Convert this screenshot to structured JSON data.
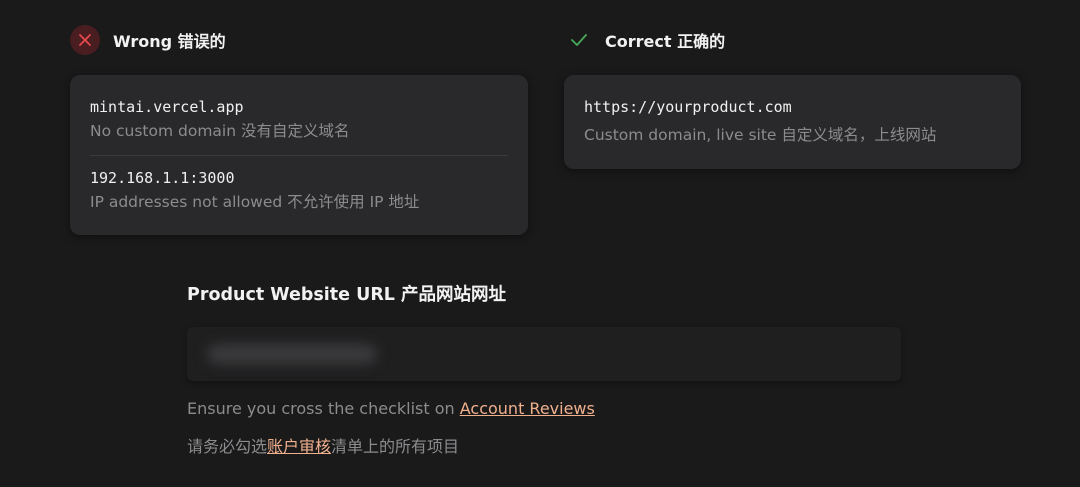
{
  "wrong": {
    "title": "Wrong  错误的",
    "examples": [
      {
        "value": "mintai.vercel.app",
        "note": "No custom domain  没有自定义域名"
      },
      {
        "value": "192.168.1.1:3000",
        "note": "IP addresses not allowed  不允许使用 IP 地址"
      }
    ]
  },
  "correct": {
    "title": "Correct  正确的",
    "examples": [
      {
        "value": "https://yourproduct.com",
        "note": "Custom domain, live site  自定义域名，上线网站"
      }
    ]
  },
  "field": {
    "label": "Product Website URL  产品网站网址"
  },
  "help": {
    "en_prefix": "Ensure you cross the checklist on ",
    "en_link": "Account Reviews",
    "zh_prefix": "请务必勾选",
    "zh_link": "账户审核",
    "zh_suffix": "清单上的所有项目"
  },
  "colors": {
    "background": "#1a1a1b",
    "card": "#29292b",
    "wrong_accent": "#e5484d",
    "correct_accent": "#46a758",
    "link": "#f0b08e"
  },
  "icons": {
    "wrong": "close-icon",
    "correct": "check-icon"
  }
}
